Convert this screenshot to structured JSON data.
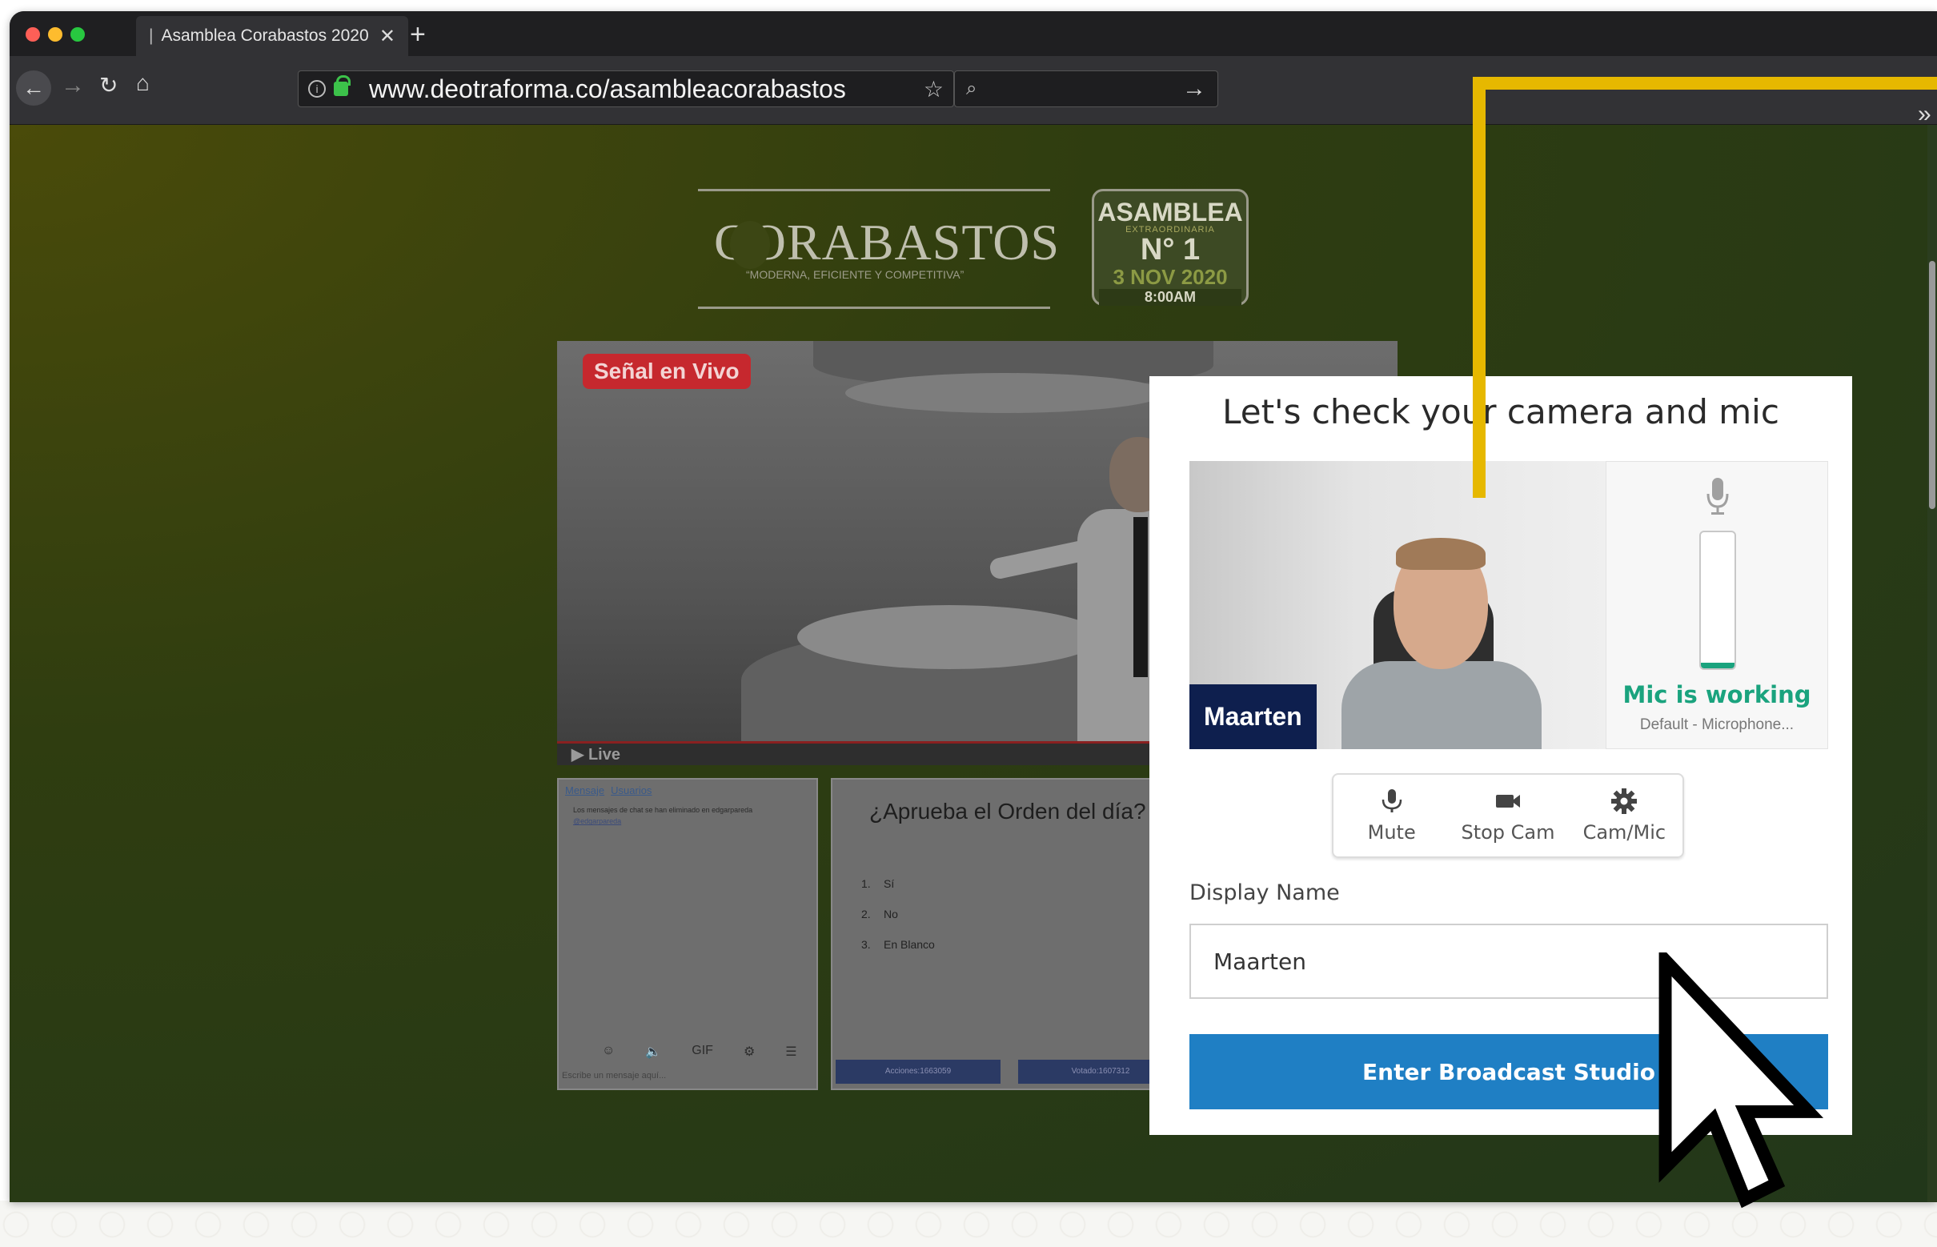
{
  "browser": {
    "tab_title": "Asamblea Corabastos 2020",
    "tab_separator": "|",
    "url": "www.deotraforma.co/asambleacorabastos",
    "search_placeholder": ""
  },
  "site": {
    "brand": "CORABASTOS",
    "brand_tagline": "“MODERNA, EFICIENTE Y COMPETITIVA”",
    "badge": {
      "line1": "ASAMBLEA",
      "line2": "EXTRAORDINARIA",
      "line3": "N° 1",
      "line4": "3 NOV 2020",
      "line5": "8:00AM"
    },
    "live_badge": "Señal en Vivo",
    "player_label": "▶ Live"
  },
  "chat": {
    "tabs": [
      "Mensaje",
      "Usuarios"
    ],
    "note_line1": "Los mensajes de chat se han eliminado en edgarpareda",
    "note_link": "@edgarpareda",
    "input_placeholder": "Escribe un mensaje aquí...",
    "tool_gif": "GIF"
  },
  "poll": {
    "question": "¿Aprueba el Orden del día?",
    "options": [
      {
        "num": "1.",
        "label": "Sí"
      },
      {
        "num": "2.",
        "label": "No"
      },
      {
        "num": "3.",
        "label": "En Blanco"
      }
    ],
    "stat_shares": "Acciones:1663059",
    "stat_voted": "Votado:1607312"
  },
  "modal": {
    "title": "Let's check your camera and mic",
    "participant_name": "Maarten",
    "mic_status": "Mic is working",
    "mic_device": "Default - Microphone...",
    "mic_level": 0.03,
    "controls": [
      {
        "label": "Mute",
        "icon": "microphone-icon"
      },
      {
        "label": "Stop Cam",
        "icon": "video-camera-icon"
      },
      {
        "label": "Cam/Mic",
        "icon": "gear-icon"
      }
    ],
    "display_name_label": "Display Name",
    "display_name_value": "Maarten",
    "enter_button": "Enter Broadcast Studio"
  },
  "colors": {
    "accent_blue": "#1f7fc4",
    "mic_green": "#1aa37e",
    "name_tag_navy": "#0e1f4e",
    "callout_yellow": "#e6b800",
    "live_red": "#c6282e"
  }
}
